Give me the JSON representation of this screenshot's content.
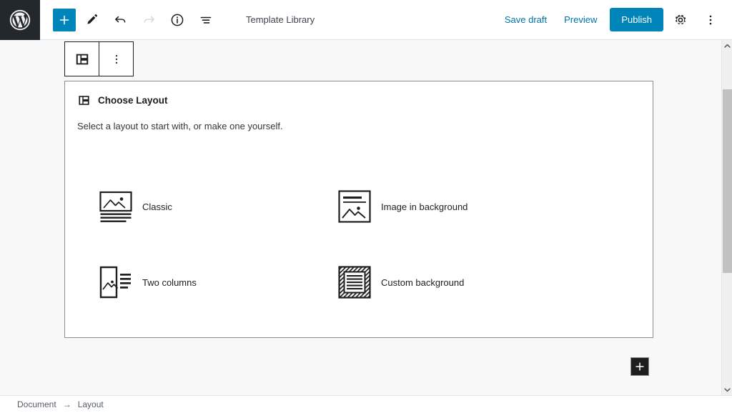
{
  "header": {
    "logo_icon": "wordpress-logo-icon",
    "title": "Template Library",
    "tools": [
      {
        "name": "add-block-button",
        "icon": "plus-icon",
        "label": "+"
      },
      {
        "name": "edit-mode-button",
        "icon": "pencil-icon",
        "label": ""
      },
      {
        "name": "undo-button",
        "icon": "undo-arrow-icon",
        "label": ""
      },
      {
        "name": "redo-button",
        "icon": "redo-arrow-icon",
        "label": ""
      },
      {
        "name": "content-info-button",
        "icon": "info-circle-icon",
        "label": ""
      },
      {
        "name": "list-view-button",
        "icon": "list-view-icon",
        "label": ""
      }
    ],
    "save_draft_label": "Save draft",
    "preview_label": "Preview",
    "publish_label": "Publish",
    "settings_icon": "gear-icon",
    "more_menu_icon": "vertical-dots-icon",
    "accent_color": "#0085ba",
    "link_color": "#0073aa"
  },
  "block_toolbar": {
    "block_icon": "layout-block-icon",
    "more_options_icon": "vertical-dots-icon"
  },
  "panel": {
    "icon": "layout-block-icon",
    "title": "Choose Layout",
    "subtitle": "Select a layout to start with, or make one yourself.",
    "options": [
      {
        "name": "layout-option-classic",
        "label": "Classic",
        "icon": "classic-layout-icon"
      },
      {
        "name": "layout-option-image-in-background",
        "label": "Image in background",
        "icon": "image-background-layout-icon"
      },
      {
        "name": "layout-option-two-columns",
        "label": "Two columns",
        "icon": "two-columns-layout-icon"
      },
      {
        "name": "layout-option-custom-background",
        "label": "Custom background",
        "icon": "custom-background-layout-icon"
      }
    ]
  },
  "canvas": {
    "add_block_icon": "plus-icon",
    "background_color": "#f8f8f8"
  },
  "scrollbar": {
    "up_arrow_icon": "chevron-up-icon",
    "down_arrow_icon": "chevron-down-icon"
  },
  "statusbar": {
    "breadcrumb": [
      "Document",
      "Layout"
    ],
    "separator": "→"
  }
}
